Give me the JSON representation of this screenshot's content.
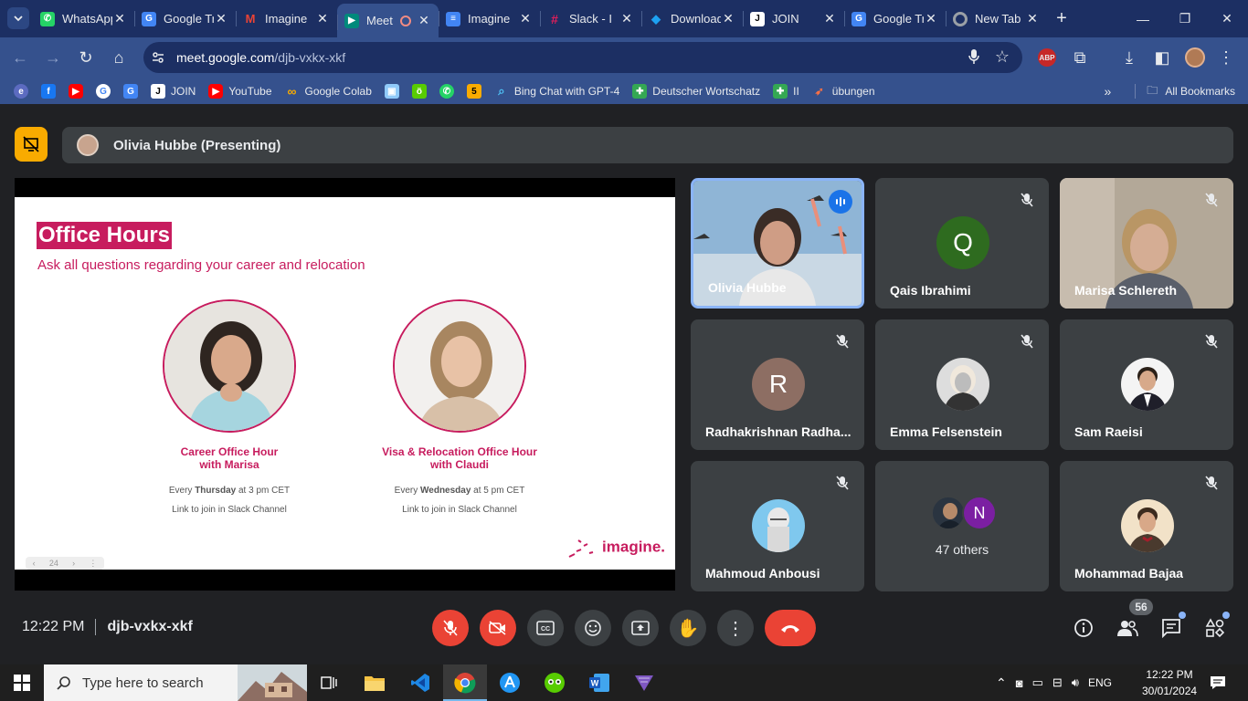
{
  "browser": {
    "tabs": [
      {
        "title": "WhatsApp",
        "icon": "whatsapp-icon",
        "color": "#25d366",
        "active": false
      },
      {
        "title": "Google Translate",
        "icon": "google-translate-icon",
        "color": "#4285f4",
        "active": false
      },
      {
        "title": "Imagine",
        "icon": "gmail-icon",
        "color": "#ea4335",
        "active": false
      },
      {
        "title": "Meet",
        "icon": "google-meet-icon",
        "color": "#00897b",
        "active": true
      },
      {
        "title": "Imagine",
        "icon": "google-docs-icon",
        "color": "#4285f4",
        "active": false
      },
      {
        "title": "Slack - I",
        "icon": "slack-icon",
        "color": "#e01e5a",
        "active": false
      },
      {
        "title": "Download",
        "icon": "download-site-icon",
        "color": "#1da1f2",
        "active": false
      },
      {
        "title": "JOIN",
        "icon": "join-icon",
        "color": "#ffffff",
        "active": false
      },
      {
        "title": "Google Translate",
        "icon": "google-translate-icon",
        "color": "#4285f4",
        "active": false
      },
      {
        "title": "New Tab",
        "icon": "chrome-icon",
        "color": "#9aa0a6",
        "active": false
      }
    ],
    "url": {
      "host": "meet.google.com",
      "path": "/djb-vxkx-xkf"
    },
    "bookmarks": [
      {
        "label": "",
        "icon": "extension-icon",
        "color": "#5c6bc0"
      },
      {
        "label": "",
        "icon": "facebook-icon",
        "color": "#1877f2"
      },
      {
        "label": "",
        "icon": "youtube-icon",
        "color": "#ff0000"
      },
      {
        "label": "",
        "icon": "google-icon",
        "color": "#ffffff"
      },
      {
        "label": "",
        "icon": "google-translate-icon",
        "color": "#4285f4"
      },
      {
        "label": "JOIN",
        "icon": "join-icon",
        "color": "#ffffff"
      },
      {
        "label": "YouTube",
        "icon": "youtube-icon",
        "color": "#ff0000"
      },
      {
        "label": "Google Colab",
        "icon": "colab-icon",
        "color": "#f9ab00"
      },
      {
        "label": "",
        "icon": "image-icon",
        "color": "#90caf9"
      },
      {
        "label": "",
        "icon": "duolingo-icon",
        "color": "#58cc02"
      },
      {
        "label": "",
        "icon": "whatsapp-icon",
        "color": "#25d366"
      },
      {
        "label": "",
        "icon": "five-icon",
        "color": "#f9ab00"
      },
      {
        "label": "Bing Chat with GPT-4",
        "icon": "bing-search-icon",
        "color": "#4fc3f7"
      },
      {
        "label": "Deutscher Wortschatz",
        "icon": "cross-icon",
        "color": "#34a853"
      },
      {
        "label": "II",
        "icon": "cross-icon",
        "color": "#34a853"
      },
      {
        "label": "übungen",
        "icon": "rocket-icon",
        "color": "#ff7043"
      }
    ],
    "all_bookmarks": "All Bookmarks"
  },
  "meet": {
    "presenting_label": "Olivia Hubbe (Presenting)",
    "slide": {
      "title": "Office Hours",
      "subtitle": "Ask all questions regarding your career and relocation",
      "hosts": [
        {
          "name": "Career Office Hour\nwith Marisa",
          "when_prefix": "Every ",
          "when_day": "Thursday",
          "when_suffix": " at 3 pm CET",
          "link": "Link to join in Slack Channel"
        },
        {
          "name": "Visa & Relocation Office Hour\nwith Claudi",
          "when_prefix": "Every ",
          "when_day": "Wednesday",
          "when_suffix": " at 5 pm CET",
          "link": "Link to join in Slack Channel"
        }
      ],
      "logo": "imagine.",
      "page_number": "24"
    },
    "participants": [
      {
        "name": "Olivia Hubbe",
        "type": "video",
        "speaking": true,
        "muted": false
      },
      {
        "name": "Qais Ibrahimi",
        "type": "letter",
        "letter": "Q",
        "color": "#2e6b1f",
        "muted": true
      },
      {
        "name": "Marisa Schlereth",
        "type": "video",
        "muted": true
      },
      {
        "name": "Radhakrishnan Radha...",
        "type": "letter",
        "letter": "R",
        "color": "#8d6e63",
        "muted": true
      },
      {
        "name": "Emma Felsenstein",
        "type": "photo",
        "muted": true
      },
      {
        "name": "Sam Raeisi",
        "type": "photo",
        "muted": true
      },
      {
        "name": "Mahmoud Anbousi",
        "type": "photo",
        "muted": true
      },
      {
        "name": "47 others",
        "type": "others",
        "letter": "N",
        "color": "#7b1fa2"
      },
      {
        "name": "Mohammad Bajaa",
        "type": "photo",
        "muted": true
      }
    ],
    "time": "12:22 PM",
    "meeting_code": "djb-vxkx-xkf",
    "participant_count": "56"
  },
  "taskbar": {
    "search_placeholder": "Type here to search",
    "language": "ENG",
    "clock_time": "12:22 PM",
    "clock_date": "30/01/2024"
  },
  "colors": {
    "accent": "#1a73e8",
    "danger": "#ea4335",
    "present": "#f9ab00",
    "brand": "#c71c5e"
  }
}
